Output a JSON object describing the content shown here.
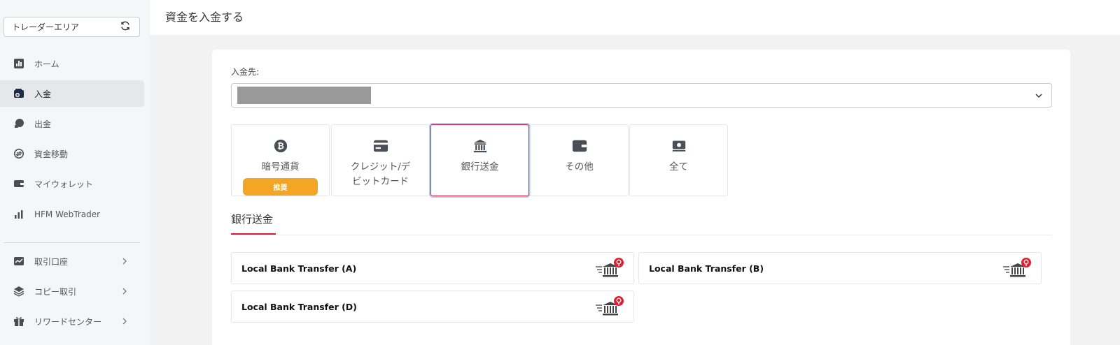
{
  "sidebar": {
    "area_label": "トレーダーエリア",
    "items": [
      {
        "label": "ホーム",
        "icon": "chart-icon"
      },
      {
        "label": "入金",
        "icon": "wallet-plus-icon"
      },
      {
        "label": "出金",
        "icon": "withdraw-icon"
      },
      {
        "label": "資金移動",
        "icon": "transfer-icon"
      },
      {
        "label": "マイウォレット",
        "icon": "wallet-icon"
      },
      {
        "label": "HFM WebTrader",
        "icon": "bars-icon"
      },
      {
        "label": "取引口座",
        "icon": "trend-icon"
      },
      {
        "label": "コピー取引",
        "icon": "layers-icon"
      },
      {
        "label": "リワードセンター",
        "icon": "gift-icon"
      }
    ]
  },
  "header": {
    "title": "資金を入金する"
  },
  "deposit": {
    "dest_label": "入金先:",
    "methods": [
      {
        "label": "暗号通貨",
        "icon": "bitcoin-icon",
        "badge": "推奨"
      },
      {
        "label": "クレジット/デビットカード",
        "icon": "credit-card-icon"
      },
      {
        "label": "銀行送金",
        "icon": "bank-icon"
      },
      {
        "label": "その他",
        "icon": "wallet-icon"
      },
      {
        "label": "全て",
        "icon": "cash-icon"
      }
    ],
    "section_title": "銀行送金",
    "banks": [
      {
        "name": "Local Bank Transfer (A)"
      },
      {
        "name": "Local Bank Transfer (B)"
      },
      {
        "name": "Local Bank Transfer (D)"
      }
    ]
  },
  "colors": {
    "accent": "#d61a3c",
    "badge": "#f4a525",
    "icon": "#4a4f57"
  }
}
